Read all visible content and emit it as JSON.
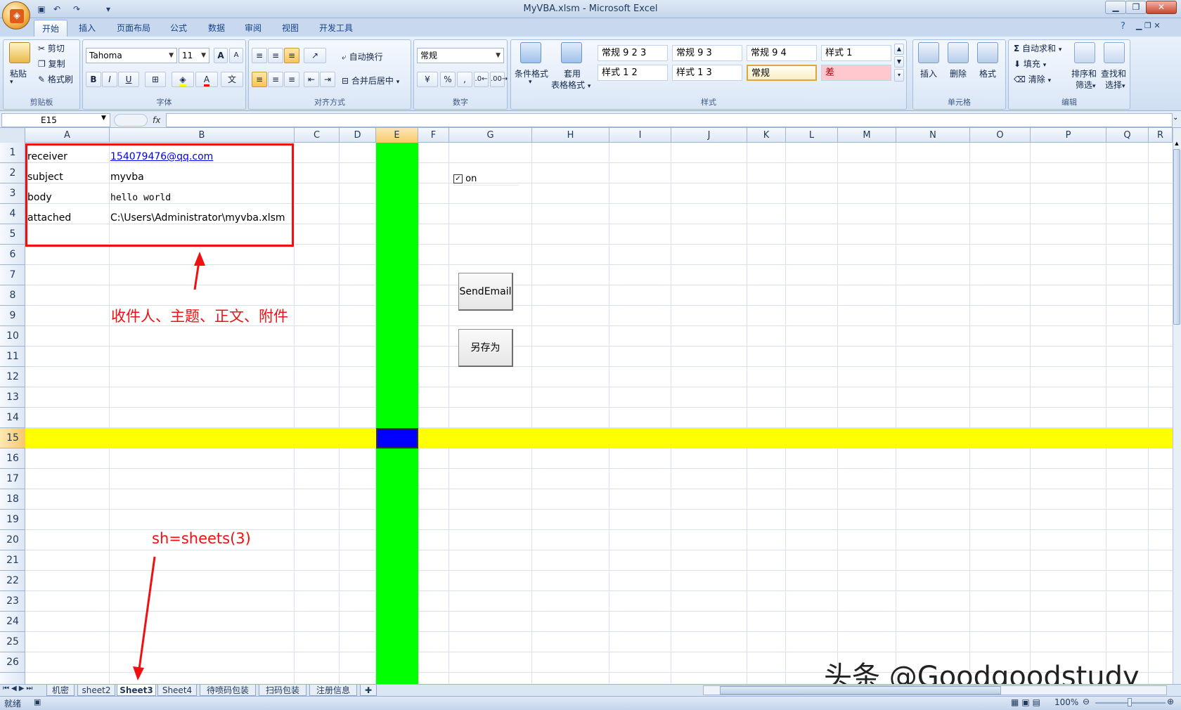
{
  "window": {
    "title": "MyVBA.xlsm - Microsoft Excel"
  },
  "quick_access": {
    "save_icon": "save-icon",
    "undo_icon": "undo-icon",
    "redo_icon": "redo-icon"
  },
  "ribbon_tabs": [
    "开始",
    "插入",
    "页面布局",
    "公式",
    "数据",
    "审阅",
    "视图",
    "开发工具"
  ],
  "clipboard": {
    "paste": "粘贴",
    "cut": "剪切",
    "copy": "复制",
    "format_painter": "格式刷",
    "label": "剪贴板"
  },
  "font": {
    "name": "Tahoma",
    "size": "11",
    "bold": "B",
    "italic": "I",
    "underline": "U",
    "grow": "A",
    "shrink": "A",
    "label": "字体"
  },
  "alignment": {
    "wrap": "自动换行",
    "merge": "合并后居中",
    "label": "对齐方式"
  },
  "number": {
    "format": "常规",
    "percent": "%",
    "comma": ",",
    "label": "数字"
  },
  "styles": {
    "cond_format": "条件格式",
    "table_format_1": "套用",
    "table_format_2": "表格格式",
    "cells": [
      "常规 9 2 3",
      "常规 9 3",
      "常规 9 4",
      "样式 1",
      "样式 1 2",
      "样式 1 3",
      "常规",
      "差"
    ],
    "label": "样式"
  },
  "cells_group": {
    "insert": "插入",
    "delete": "删除",
    "format": "格式",
    "label": "单元格"
  },
  "editing": {
    "autosum": "自动求和",
    "fill": "填充",
    "clear": "清除",
    "sort_1": "排序和",
    "sort_2": "筛选",
    "find_1": "查找和",
    "find_2": "选择",
    "label": "编辑"
  },
  "formula_bar": {
    "name_box": "E15",
    "fx": "fx",
    "value": ""
  },
  "columns": [
    "A",
    "B",
    "C",
    "D",
    "E",
    "F",
    "G",
    "H",
    "I",
    "J",
    "K",
    "L",
    "M",
    "N",
    "O",
    "P",
    "Q",
    "R"
  ],
  "rows": [
    "1",
    "2",
    "3",
    "4",
    "5",
    "6",
    "7",
    "8",
    "9",
    "10",
    "11",
    "12",
    "13",
    "14",
    "15",
    "16",
    "17",
    "18",
    "19",
    "20",
    "21",
    "22",
    "23",
    "24",
    "25",
    "26"
  ],
  "data_cells": {
    "a1": "receiver",
    "b1": "154079476@qq.com",
    "a2": "subject",
    "b2": "myvba",
    "a3": "body",
    "b3": "hello world",
    "a4": "attached",
    "b4": "C:\\Users\\Administrator\\myvba.xlsm"
  },
  "controls": {
    "checkbox_label": "on",
    "checkbox_checked": true,
    "send_button": "SendEmail",
    "save_as_button": "另存为"
  },
  "annotations": {
    "fields_note": "收件人、主题、正文、附件",
    "sheet_note": "sh=sheets(3)"
  },
  "sheet_tabs": [
    "机密",
    "sheet2",
    "Sheet3",
    "Sheet4",
    "待喷码包装",
    "扫码包装",
    "注册信息"
  ],
  "active_sheet": "Sheet3",
  "status": {
    "ready": "就绪",
    "zoom": "100%"
  },
  "watermark": "头条 @Goodgoodstudy",
  "colors": {
    "highlight_row": "#ffff00",
    "highlight_col": "#00ff00",
    "active_cell": "#0000ff",
    "annotation": "#f01010"
  }
}
